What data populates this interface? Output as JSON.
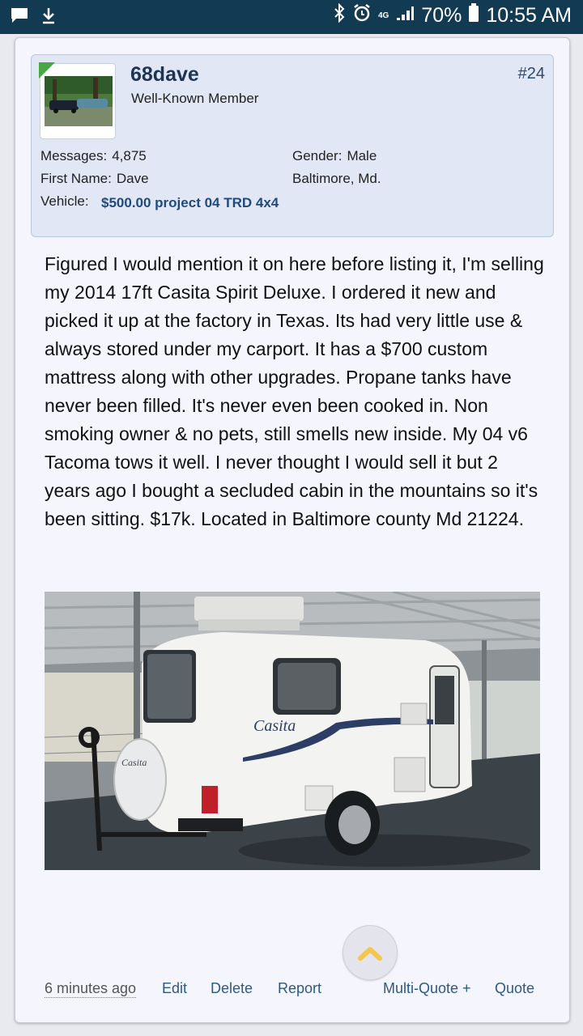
{
  "statusbar": {
    "battery": "70%",
    "time": "10:55 AM",
    "network": "4G"
  },
  "post": {
    "username": "68dave",
    "user_title": "Well-Known Member",
    "post_number": "#24",
    "messages_label": "Messages:",
    "messages_value": "4,875",
    "first_name_label": "First Name:",
    "first_name_value": "Dave",
    "vehicle_label": "Vehicle:",
    "vehicle_value": "$500.00 project 04 TRD 4x4",
    "gender_label": "Gender:",
    "gender_value": "Male",
    "location": "Baltimore, Md.",
    "body": "Figured I would mention it on here before listing it, I'm selling my 2014 17ft Casita Spirit Deluxe. I ordered it new and picked it up at the factory in Texas. Its had very little use & always stored under my carport. It has a $700 custom mattress along with other upgrades. Propane tanks have never been filled. It's never even been cooked in. Non smoking owner & no pets, still smells new inside. My 04 v6 Tacoma tows it well. I never thought I would sell it but 2 years ago I bought a secluded cabin in the mountains so it's been sitting. $17k. Located in Baltimore county Md 21224.",
    "photo_brand": "Casita",
    "spare_cover_text": "Casita"
  },
  "footer": {
    "time": "6 minutes ago",
    "edit": "Edit",
    "delete": "Delete",
    "report": "Report",
    "multiquote": "Multi-Quote +",
    "quote": "Quote"
  },
  "colors": {
    "statusbar": "#123a52",
    "link": "#2d5a84",
    "username": "#1c3553"
  }
}
